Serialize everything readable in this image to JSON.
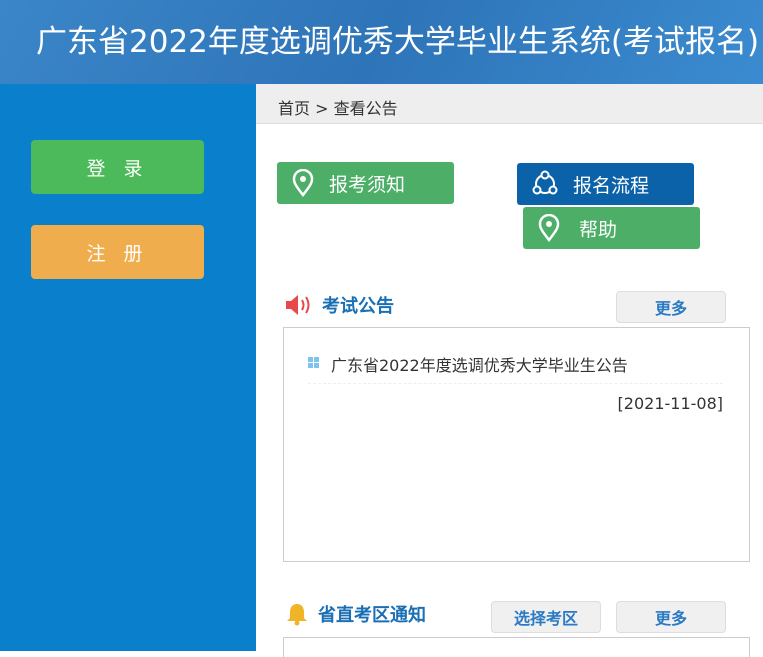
{
  "header": {
    "title": "广东省2022年度选调优秀大学毕业生系统(考试报名)"
  },
  "sidebar": {
    "login": "登 录",
    "register": "注 册"
  },
  "breadcrumb": "首页 > 查看公告",
  "actions": {
    "notice": "报考须知",
    "process": "报名流程",
    "help": "帮助"
  },
  "exam_notices": {
    "title": "考试公告",
    "more": "更多",
    "items": [
      {
        "title": "广东省2022年度选调优秀大学毕业生公告",
        "date": "[2021-11-08]"
      }
    ]
  },
  "district_notices": {
    "title": "省直考区通知",
    "select": "选择考区",
    "more": "更多"
  }
}
